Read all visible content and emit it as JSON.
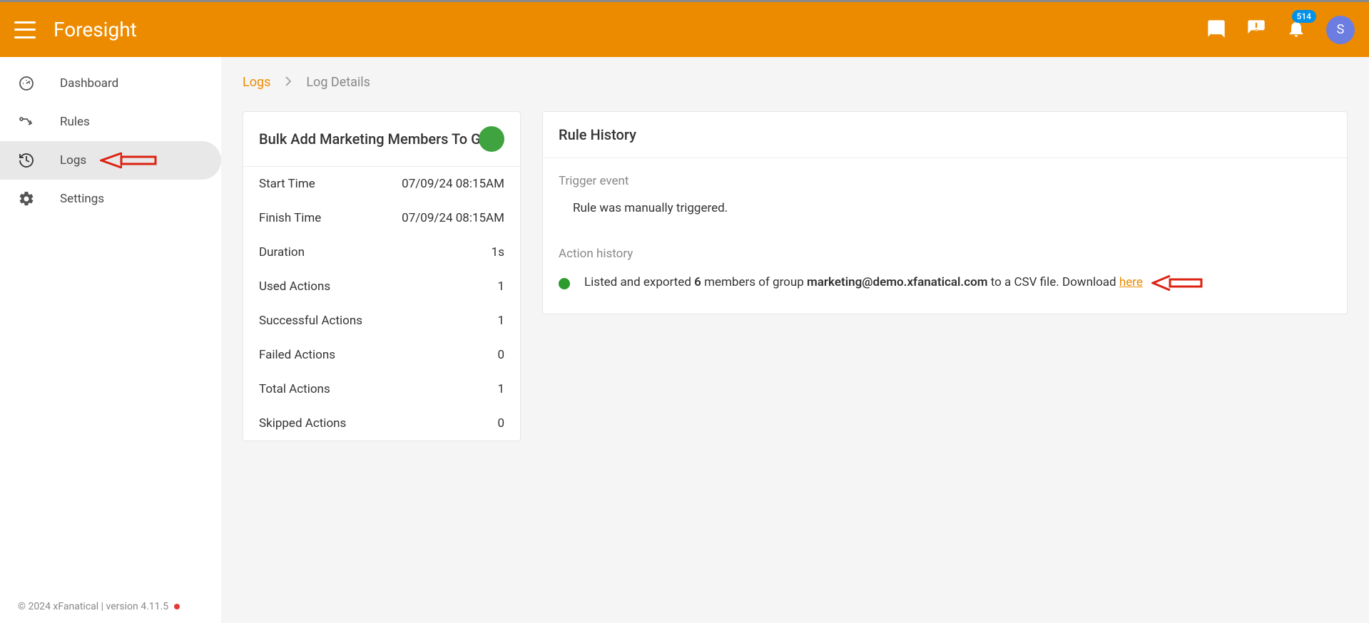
{
  "header": {
    "app_title": "Foresight",
    "notification_count": "514",
    "avatar_initial": "S"
  },
  "sidebar": {
    "items": [
      {
        "label": "Dashboard"
      },
      {
        "label": "Rules"
      },
      {
        "label": "Logs"
      },
      {
        "label": "Settings"
      }
    ]
  },
  "footer": {
    "text": "© 2024 xFanatical | version 4.11.5"
  },
  "breadcrumb": {
    "link": "Logs",
    "current": "Log Details"
  },
  "details_card": {
    "title": "Bulk Add Marketing Members To Go",
    "rows": {
      "start_label": "Start Time",
      "start_value": "07/09/24 08:15AM",
      "finish_label": "Finish Time",
      "finish_value": "07/09/24 08:15AM",
      "duration_label": "Duration",
      "duration_value": "1s",
      "used_label": "Used Actions",
      "used_value": "1",
      "successful_label": "Successful Actions",
      "successful_value": "1",
      "failed_label": "Failed Actions",
      "failed_value": "0",
      "total_label": "Total Actions",
      "total_value": "1",
      "skipped_label": "Skipped Actions",
      "skipped_value": "0"
    }
  },
  "history_card": {
    "title": "Rule History",
    "trigger_label": "Trigger event",
    "trigger_text": "Rule was manually triggered.",
    "action_label": "Action history",
    "action_pre": "Listed and exported ",
    "action_count": "6",
    "action_mid": " members of group ",
    "action_group": "marketing@demo.xfanatical.com",
    "action_post": " to a CSV file. Download ",
    "action_link": "here"
  }
}
